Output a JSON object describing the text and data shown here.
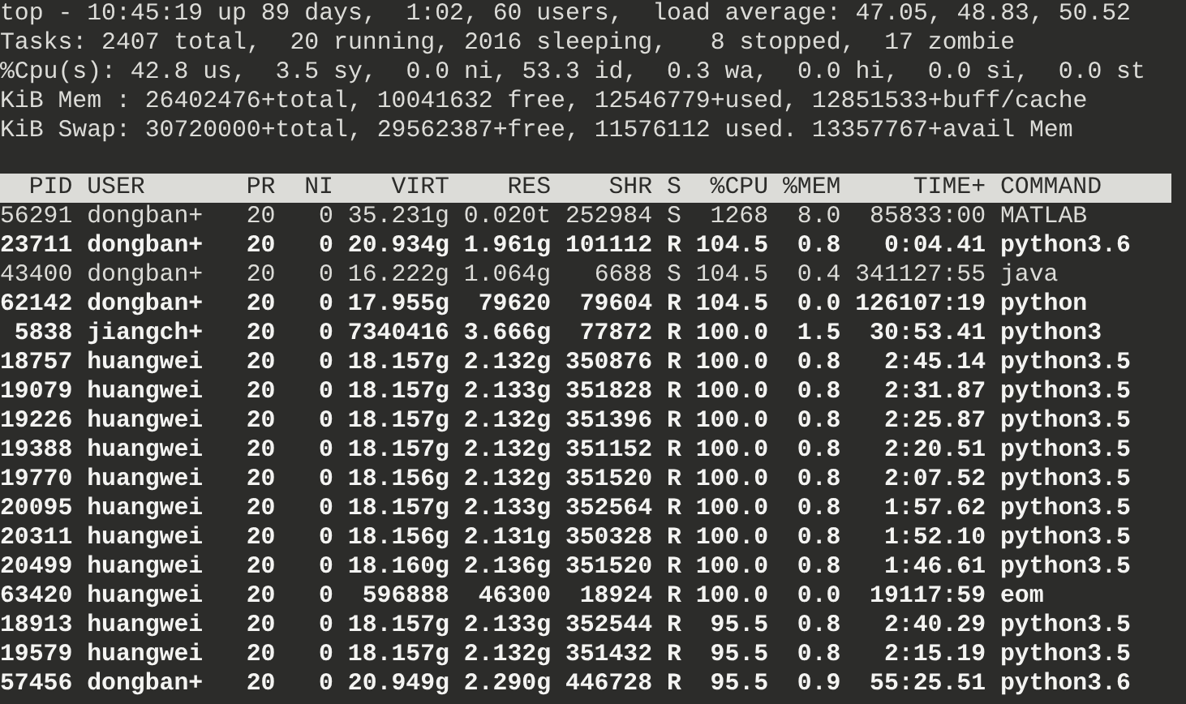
{
  "summary": [
    "top - 10:45:19 up 89 days,  1:02, 60 users,  load average: 47.05, 48.83, 50.52",
    "Tasks: 2407 total,  20 running, 2016 sleeping,   8 stopped,  17 zombie",
    "%Cpu(s): 42.8 us,  3.5 sy,  0.0 ni, 53.3 id,  0.3 wa,  0.0 hi,  0.0 si,  0.0 st",
    "KiB Mem : 26402476+total, 10041632 free, 12546779+used, 12851533+buff/cache",
    "KiB Swap: 30720000+total, 29562387+free, 11576112 used. 13357767+avail Mem"
  ],
  "table": {
    "columns": [
      "PID",
      "USER",
      "PR",
      "NI",
      "VIRT",
      "RES",
      "SHR",
      "S",
      "%CPU",
      "%MEM",
      "TIME+",
      "COMMAND"
    ],
    "rows": [
      {
        "cells": [
          "56291",
          "dongban+",
          "20",
          "0",
          "35.231g",
          "0.020t",
          "252984",
          "S",
          "1268",
          "8.0",
          "85833:00",
          "MATLAB"
        ],
        "bold": false
      },
      {
        "cells": [
          "23711",
          "dongban+",
          "20",
          "0",
          "20.934g",
          "1.961g",
          "101112",
          "R",
          "104.5",
          "0.8",
          "0:04.41",
          "python3.6"
        ],
        "bold": true
      },
      {
        "cells": [
          "43400",
          "dongban+",
          "20",
          "0",
          "16.222g",
          "1.064g",
          "6688",
          "S",
          "104.5",
          "0.4",
          "341127:55",
          "java"
        ],
        "bold": false
      },
      {
        "cells": [
          "62142",
          "dongban+",
          "20",
          "0",
          "17.955g",
          "79620",
          "79604",
          "R",
          "104.5",
          "0.0",
          "126107:19",
          "python"
        ],
        "bold": true
      },
      {
        "cells": [
          "5838",
          "jiangch+",
          "20",
          "0",
          "7340416",
          "3.666g",
          "77872",
          "R",
          "100.0",
          "1.5",
          "30:53.41",
          "python3"
        ],
        "bold": true
      },
      {
        "cells": [
          "18757",
          "huangwei",
          "20",
          "0",
          "18.157g",
          "2.132g",
          "350876",
          "R",
          "100.0",
          "0.8",
          "2:45.14",
          "python3.5"
        ],
        "bold": true
      },
      {
        "cells": [
          "19079",
          "huangwei",
          "20",
          "0",
          "18.157g",
          "2.133g",
          "351828",
          "R",
          "100.0",
          "0.8",
          "2:31.87",
          "python3.5"
        ],
        "bold": true
      },
      {
        "cells": [
          "19226",
          "huangwei",
          "20",
          "0",
          "18.157g",
          "2.132g",
          "351396",
          "R",
          "100.0",
          "0.8",
          "2:25.87",
          "python3.5"
        ],
        "bold": true
      },
      {
        "cells": [
          "19388",
          "huangwei",
          "20",
          "0",
          "18.157g",
          "2.132g",
          "351152",
          "R",
          "100.0",
          "0.8",
          "2:20.51",
          "python3.5"
        ],
        "bold": true
      },
      {
        "cells": [
          "19770",
          "huangwei",
          "20",
          "0",
          "18.156g",
          "2.132g",
          "351520",
          "R",
          "100.0",
          "0.8",
          "2:07.52",
          "python3.5"
        ],
        "bold": true
      },
      {
        "cells": [
          "20095",
          "huangwei",
          "20",
          "0",
          "18.157g",
          "2.133g",
          "352564",
          "R",
          "100.0",
          "0.8",
          "1:57.62",
          "python3.5"
        ],
        "bold": true
      },
      {
        "cells": [
          "20311",
          "huangwei",
          "20",
          "0",
          "18.156g",
          "2.131g",
          "350328",
          "R",
          "100.0",
          "0.8",
          "1:52.10",
          "python3.5"
        ],
        "bold": true
      },
      {
        "cells": [
          "20499",
          "huangwei",
          "20",
          "0",
          "18.160g",
          "2.136g",
          "351520",
          "R",
          "100.0",
          "0.8",
          "1:46.61",
          "python3.5"
        ],
        "bold": true
      },
      {
        "cells": [
          "63420",
          "huangwei",
          "20",
          "0",
          "596888",
          "46300",
          "18924",
          "R",
          "100.0",
          "0.0",
          "19117:59",
          "eom"
        ],
        "bold": true
      },
      {
        "cells": [
          "18913",
          "huangwei",
          "20",
          "0",
          "18.157g",
          "2.133g",
          "352544",
          "R",
          "95.5",
          "0.8",
          "2:40.29",
          "python3.5"
        ],
        "bold": true
      },
      {
        "cells": [
          "19579",
          "huangwei",
          "20",
          "0",
          "18.157g",
          "2.132g",
          "351432",
          "R",
          "95.5",
          "0.8",
          "2:15.19",
          "python3.5"
        ],
        "bold": true
      },
      {
        "cells": [
          "57456",
          "dongban+",
          "20",
          "0",
          "20.949g",
          "2.290g",
          "446728",
          "R",
          "95.5",
          "0.9",
          "55:25.51",
          "python3.6"
        ],
        "bold": true
      }
    ]
  }
}
